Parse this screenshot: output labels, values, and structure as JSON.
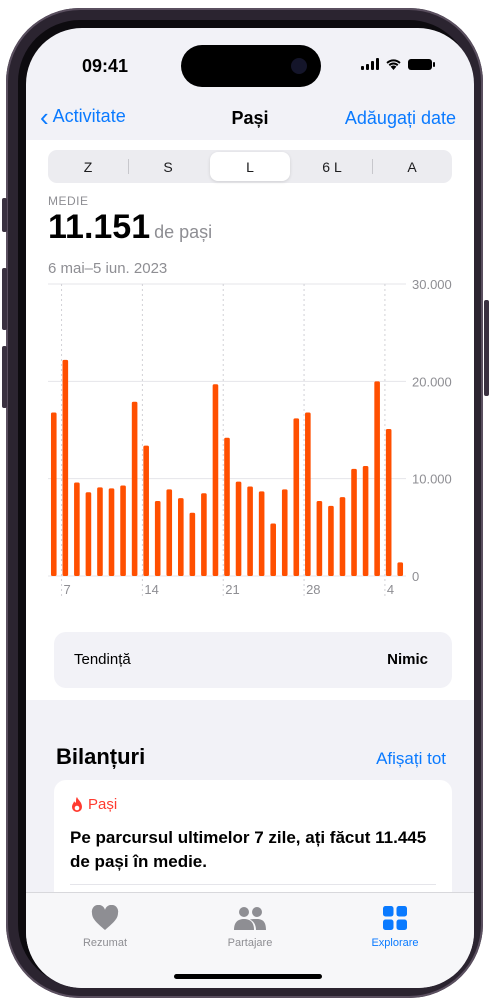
{
  "status_bar": {
    "time": "09:41"
  },
  "nav": {
    "back_label": "Activitate",
    "title": "Pași",
    "add_label": "Adăugați date"
  },
  "segments": {
    "items": [
      "Z",
      "S",
      "L",
      "6 L",
      "A"
    ],
    "selected": "L"
  },
  "summary": {
    "label": "MEDIE",
    "value": "11.151",
    "unit": "de pași",
    "range": "6 mai–5 iun. 2023"
  },
  "chart_data": {
    "type": "bar",
    "color": "#ff4f00",
    "y_ticks": [
      "30.000",
      "20.000",
      "10.000",
      "0"
    ],
    "ylim": [
      0,
      30000
    ],
    "x_ticks": [
      "7",
      "14",
      "21",
      "28",
      "4"
    ],
    "values": [
      16800,
      22200,
      9600,
      8600,
      9100,
      9000,
      9300,
      17900,
      13400,
      7700,
      8900,
      8000,
      6500,
      8500,
      19700,
      14200,
      9700,
      9200,
      8700,
      5400,
      8900,
      16200,
      16800,
      7700,
      7200,
      8100,
      11000,
      11300,
      20000,
      15100,
      1400
    ]
  },
  "trend": {
    "label": "Tendință",
    "value": "Nimic"
  },
  "highlights": {
    "title": "Bilanțuri",
    "link": "Afișați tot",
    "card": {
      "category": "Pași",
      "text": "Pe parcursul ultimelor 7 zile, ați făcut 11.445 de pași în medie."
    }
  },
  "tabbar": {
    "items": [
      {
        "label": "Rezumat",
        "icon": "heart-icon"
      },
      {
        "label": "Partajare",
        "icon": "people-icon"
      },
      {
        "label": "Explorare",
        "icon": "grid-icon"
      }
    ]
  },
  "colors": {
    "accent": "#0a7aff",
    "steps": "#ff4f00"
  }
}
